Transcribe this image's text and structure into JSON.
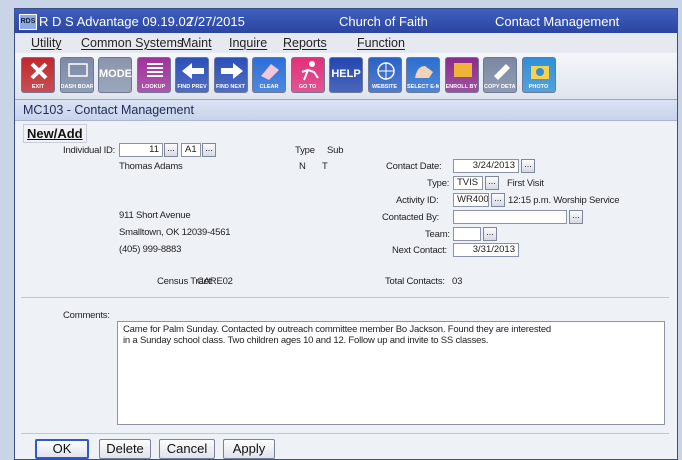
{
  "window": {
    "app_name": "R D S Advantage 09.19.02",
    "date": "7/27/2015",
    "organization": "Church of Faith",
    "module": "Contact Management",
    "icon_label": "RDS"
  },
  "menu": [
    "Utility",
    "Common Systems",
    "Maint",
    "Inquire",
    "Reports",
    "Function"
  ],
  "toolbar": [
    {
      "name": "exit",
      "label": "EXIT",
      "color": "#c0282d",
      "icon": "x-icon"
    },
    {
      "name": "dash-board",
      "label": "DASH BOARD",
      "color": "#7d8aa6",
      "icon": "dashboard-icon"
    },
    {
      "name": "mode",
      "label": "MODE",
      "color": "#8a95ad",
      "icon": "mode-icon"
    },
    {
      "name": "lookup",
      "label": "LOOKUP",
      "color": "#a0329a",
      "icon": "list-icon"
    },
    {
      "name": "find-prev",
      "label": "FIND PREV",
      "color": "#2c4fb8",
      "icon": "arrow-left-icon"
    },
    {
      "name": "find-next",
      "label": "FIND NEXT",
      "color": "#2c4fb8",
      "icon": "arrow-right-icon"
    },
    {
      "name": "clear",
      "label": "CLEAR",
      "color": "#2c6fd8",
      "icon": "eraser-icon"
    },
    {
      "name": "go-to",
      "label": "GO TO",
      "color": "#e0307a",
      "icon": "runner-icon"
    },
    {
      "name": "help",
      "label": "HELP",
      "color": "#2346b0",
      "icon": "help-icon"
    },
    {
      "name": "website",
      "label": "WEBSITE",
      "color": "#2b62c8",
      "icon": "globe-icon"
    },
    {
      "name": "select-emails",
      "label": "SELECT E-MAILS",
      "color": "#2b6fd0",
      "icon": "hand-icon"
    },
    {
      "name": "enroll-by-individual",
      "label": "ENROLL BY INDIVIDUAL",
      "color": "#8c2b8c",
      "icon": "enroll-icon"
    },
    {
      "name": "copy-detail",
      "label": "COPY DETAIL",
      "color": "#7b87a3",
      "icon": "copy-icon"
    },
    {
      "name": "photo",
      "label": "PHOTO",
      "color": "#2f8fd8",
      "icon": "camera-icon"
    }
  ],
  "form_title": "MC103 - Contact Management",
  "new_add": "New/Add",
  "individual": {
    "label": "Individual ID:",
    "id": "11",
    "code": "A1",
    "type_label": "Type",
    "sub_label": "Sub",
    "type_value": "N",
    "sub_value": "T",
    "name": "Thomas Adams",
    "address1": "911 Short Avenue",
    "address2": "Smalltown, OK 12039-4561",
    "phone": "(405) 999-8883",
    "census_label": "Census Tract:",
    "census_value": "CARE02"
  },
  "contact": {
    "date_label": "Contact Date:",
    "date": "3/24/2013",
    "type_label": "Type:",
    "type": "TVIS",
    "type_desc": "First Visit",
    "activity_label": "Activity ID:",
    "activity": "WR400",
    "activity_desc": "12:15 p.m. Worship Service",
    "contacted_by_label": "Contacted By:",
    "contacted_by": "",
    "team_label": "Team:",
    "team": "",
    "next_label": "Next Contact:",
    "next": "3/31/2013",
    "total_label": "Total Contacts:",
    "total": "03"
  },
  "comments": {
    "label": "Comments:",
    "line1": "Came for Palm Sunday. Contacted by outreach committee member Bo Jackson. Found they are interested",
    "line2": "in a Sunday school class. Two children ages 10 and 12. Follow up and invite to SS classes."
  },
  "buttons": {
    "ok": "OK",
    "delete": "Delete",
    "cancel": "Cancel",
    "apply": "Apply"
  },
  "lookup_glyph": "..."
}
